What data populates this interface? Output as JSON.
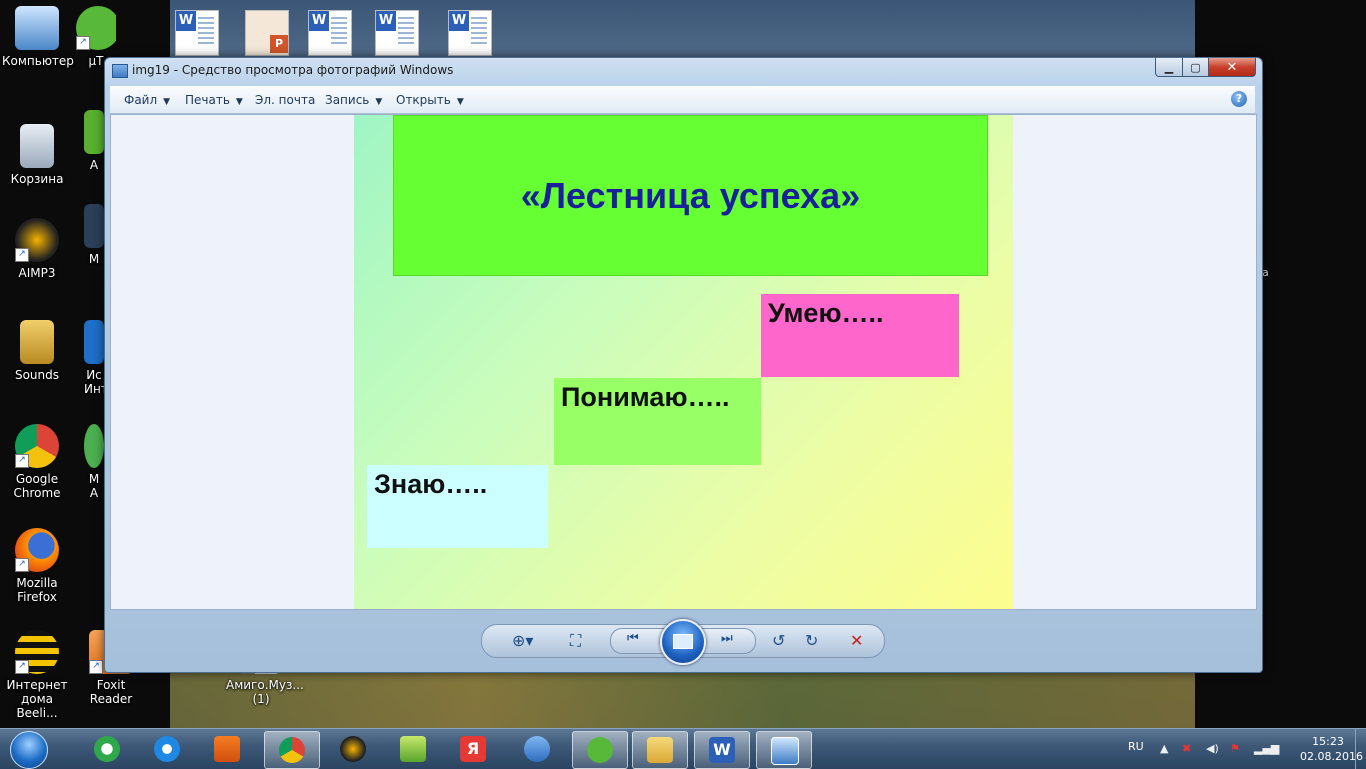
{
  "desktop": {
    "icons": [
      {
        "label": "Компьютер",
        "icon": "computer-icon"
      },
      {
        "label": "µT",
        "icon": "utorrent-icon"
      },
      {
        "label": "Корзина",
        "icon": "recycle-bin-icon"
      },
      {
        "label": "A",
        "icon": "app-icon"
      },
      {
        "label": "AIMP3",
        "icon": "aimp-icon"
      },
      {
        "label": "M",
        "icon": "app-icon"
      },
      {
        "label": "Sounds",
        "icon": "folder-icon"
      },
      {
        "label": "Ис Инт",
        "icon": "app-icon"
      },
      {
        "label": "Google Chrome",
        "icon": "chrome-icon"
      },
      {
        "label": "M A",
        "icon": "app-icon"
      },
      {
        "label": "Mozilla Firefox",
        "icon": "firefox-icon"
      },
      {
        "label": "Интернет дома Beeli...",
        "icon": "beeline-icon"
      },
      {
        "label": "Foxit Reader",
        "icon": "foxit-icon"
      },
      {
        "label": "Амиго.Муз... (1)",
        "icon": "amigo-music-icon"
      }
    ],
    "right_edge_text": "а"
  },
  "window": {
    "title": "img19 - Средство просмотра фотографий Windows",
    "menu": [
      {
        "label": "Файл",
        "dropdown": true
      },
      {
        "label": "Печать",
        "dropdown": true
      },
      {
        "label": "Эл. почта",
        "dropdown": false
      },
      {
        "label": "Запись",
        "dropdown": true
      },
      {
        "label": "Открыть",
        "dropdown": true
      }
    ],
    "help_label": "?",
    "slide": {
      "title": "«Лестница успеха»",
      "steps": [
        "Умею…..",
        "Понимаю…..",
        "Знаю….."
      ],
      "colors": {
        "title_bg": "#66ff33",
        "title_text": "#1a1f9a",
        "step1": "#ff66cc",
        "step2": "#99ff66",
        "step3": "#ccffff"
      }
    }
  },
  "taskbar": {
    "apps": [
      "mail-agent-icon",
      "internet-explorer-icon",
      "media-player-icon",
      "chrome-icon",
      "aimp-icon",
      "music-icon",
      "yandex-icon",
      "sound-icon",
      "utorrent-icon",
      "explorer-icon",
      "word-icon",
      "photo-viewer-icon"
    ],
    "language": "RU",
    "time": "15:23",
    "date": "02.08.2016"
  }
}
